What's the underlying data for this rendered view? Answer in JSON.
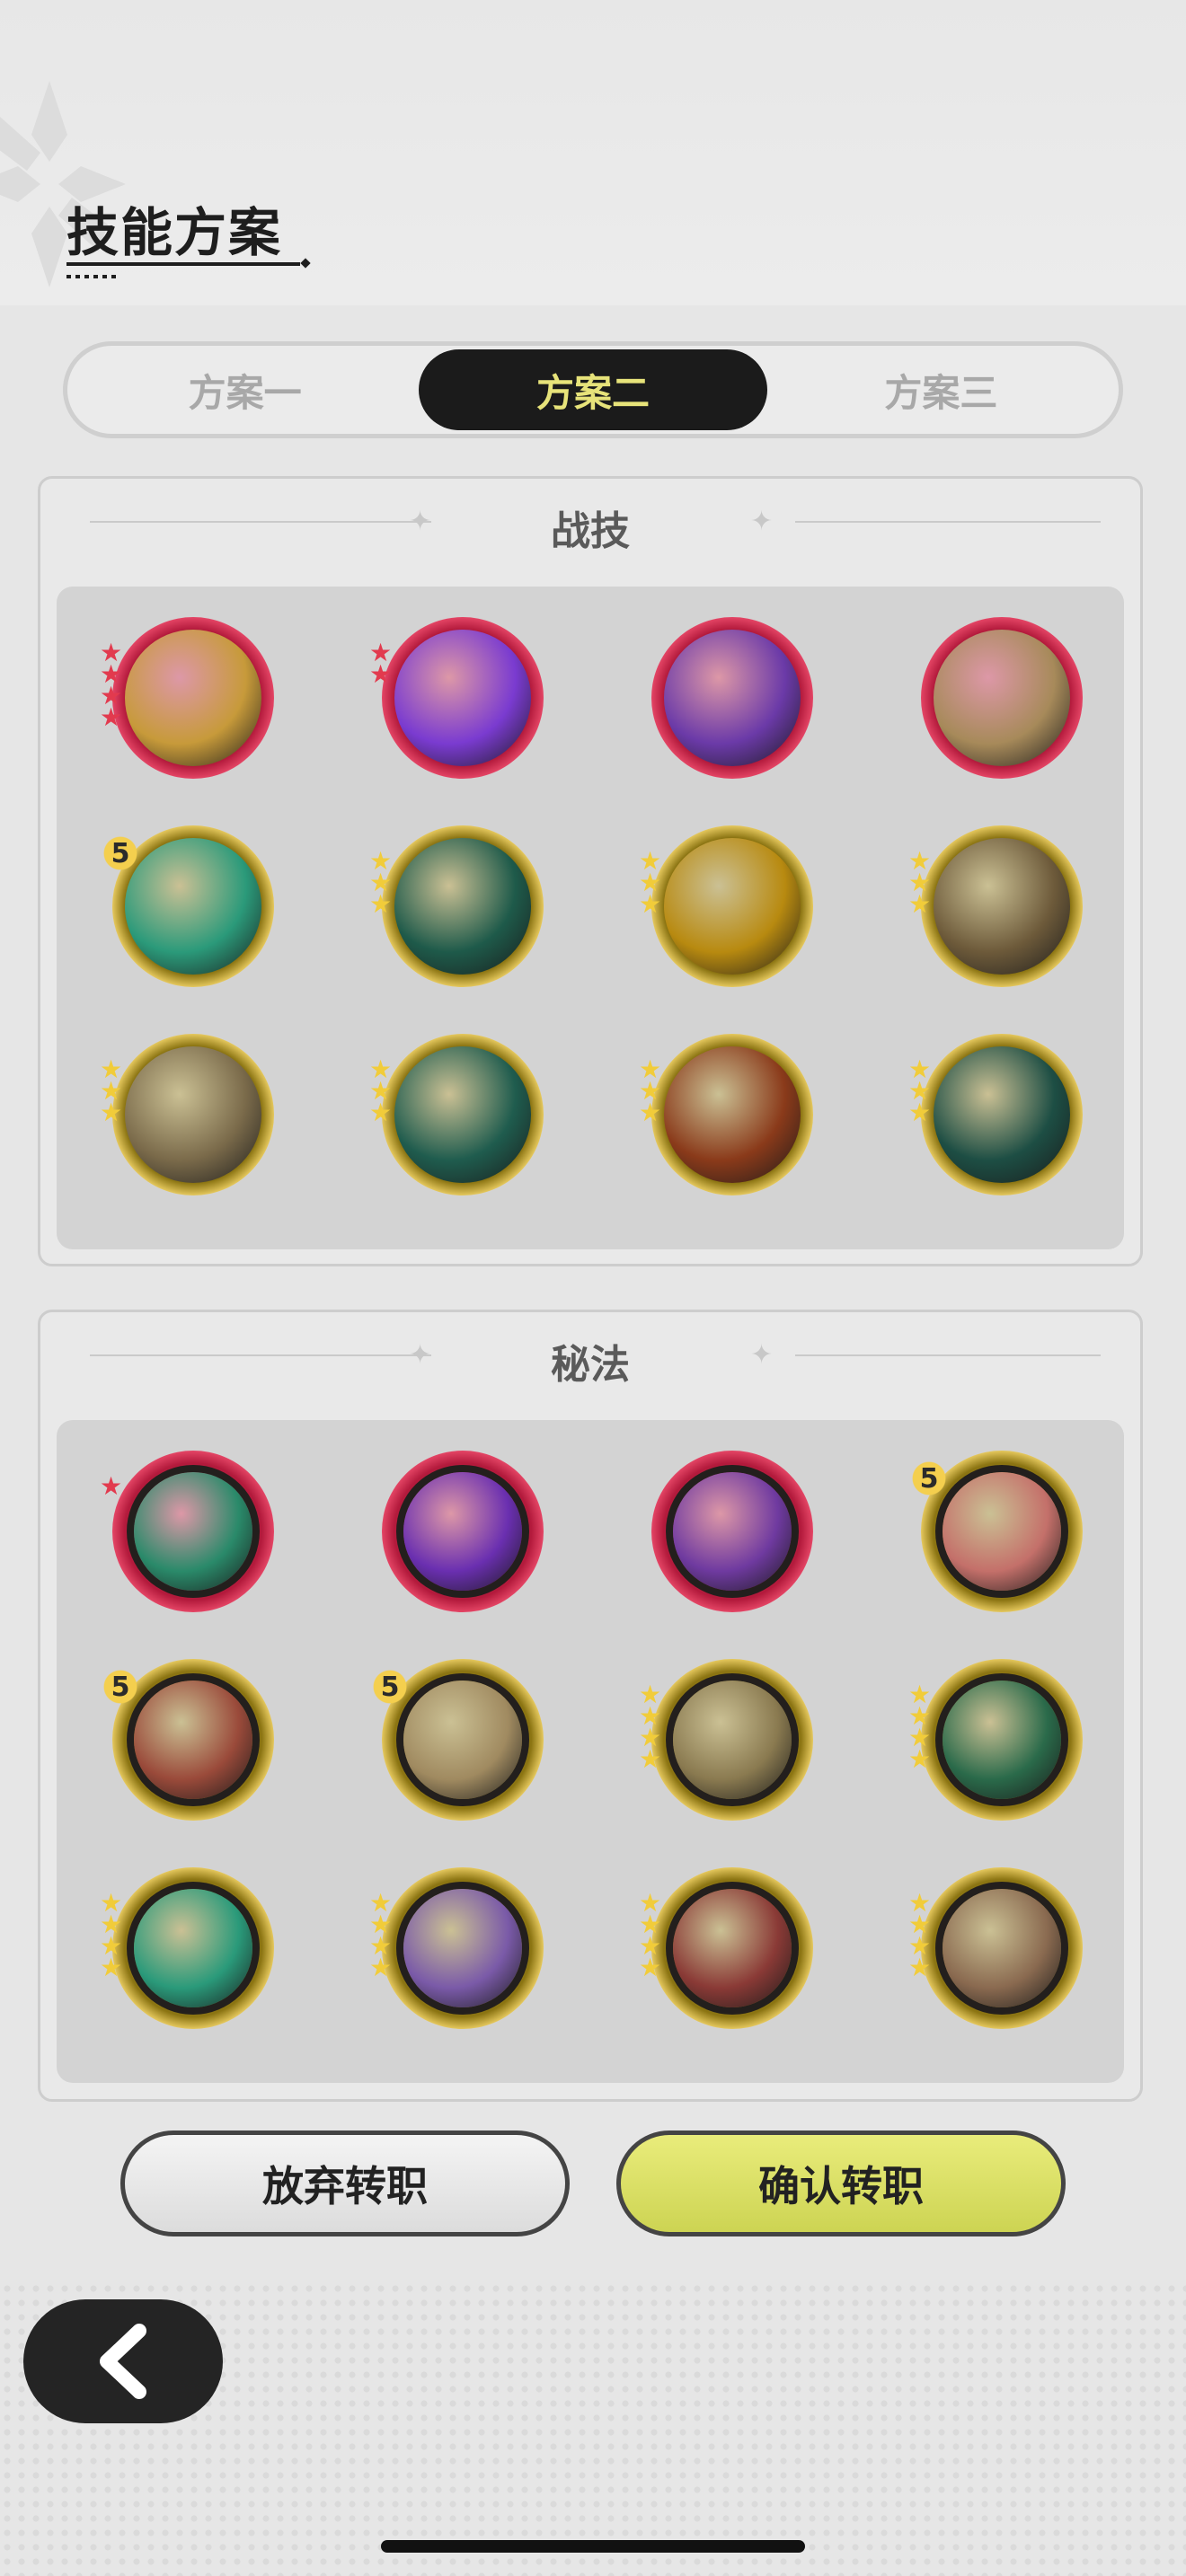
{
  "header": {
    "title": "技能方案"
  },
  "tabs": [
    {
      "label": "方案一",
      "active": false
    },
    {
      "label": "方案二",
      "active": true
    },
    {
      "label": "方案三",
      "active": false
    }
  ],
  "combat_panel": {
    "title": "战技",
    "icons": [
      {
        "name": "combat-skill-golden-swirl-icon",
        "frame": "red",
        "rank": 4,
        "rank_color": "red",
        "bg": "#c79a3a"
      },
      {
        "name": "combat-skill-purple-heart-icon",
        "frame": "red",
        "rank": 2,
        "rank_color": "red",
        "bg": "#7a3bd0"
      },
      {
        "name": "combat-skill-purple-claw-icon",
        "frame": "red",
        "rank": 0,
        "rank_color": "red",
        "bg": "#6b3aa8"
      },
      {
        "name": "combat-skill-dark-grab-icon",
        "frame": "red",
        "rank": 0,
        "rank_color": "red",
        "bg": "#a78a5a"
      },
      {
        "name": "combat-skill-green-rise-icon",
        "frame": "gold",
        "five": "5",
        "bg": "#2b9a7a"
      },
      {
        "name": "combat-skill-green-dash-icon",
        "frame": "gold",
        "rank": 3,
        "rank_color": "gold",
        "bg": "#1e5a4a"
      },
      {
        "name": "combat-skill-golden-shield-icon",
        "frame": "gold",
        "rank": 3,
        "rank_color": "gold",
        "bg": "#b88a10"
      },
      {
        "name": "combat-skill-crescent-slash-icon",
        "frame": "gold",
        "rank": 3,
        "rank_color": "gold",
        "bg": "#6d5a3a"
      },
      {
        "name": "combat-skill-impact-figure-icon",
        "frame": "gold",
        "rank": 3,
        "rank_color": "gold",
        "bg": "#7a6a4a"
      },
      {
        "name": "combat-skill-web-icon",
        "frame": "gold",
        "rank": 3,
        "rank_color": "gold",
        "bg": "#1f5c4e"
      },
      {
        "name": "combat-skill-flame-slash-icon",
        "frame": "gold",
        "rank": 3,
        "rank_color": "gold",
        "bg": "#8a3a1a"
      },
      {
        "name": "combat-skill-green-sword-icon",
        "frame": "gold",
        "rank": 3,
        "rank_color": "gold",
        "bg": "#1d4e44"
      }
    ]
  },
  "arcane_panel": {
    "title": "秘法",
    "icons": [
      {
        "name": "arcane-healing-totem-icon",
        "frame": "red",
        "rank": 1,
        "rank_color": "red",
        "bg": "#2a8a6a"
      },
      {
        "name": "arcane-purple-flame-icon",
        "frame": "red",
        "rank": 0,
        "rank_color": "red",
        "bg": "#6a2fb0"
      },
      {
        "name": "arcane-purple-figure-icon",
        "frame": "red",
        "rank": 0,
        "rank_color": "red",
        "bg": "#6f3aa0"
      },
      {
        "name": "arcane-sword-plus-icon",
        "frame": "gold",
        "five": "5",
        "bg": "#c4706a"
      },
      {
        "name": "arcane-red-shatter-icon",
        "frame": "gold",
        "five": "5",
        "bg": "#9a4a3a"
      },
      {
        "name": "arcane-leaf-icon",
        "frame": "gold",
        "five": "5",
        "bg": "#a08a60"
      },
      {
        "name": "arcane-armor-golem-icon",
        "frame": "gold",
        "rank": 4,
        "rank_color": "gold",
        "bg": "#8a7a50"
      },
      {
        "name": "arcane-green-heart-icon",
        "frame": "gold",
        "rank": 4,
        "rank_color": "gold",
        "bg": "#2a6a4a"
      },
      {
        "name": "arcane-green-blade-icon",
        "frame": "gold",
        "rank": 4,
        "rank_color": "gold",
        "bg": "#2a9a7a"
      },
      {
        "name": "arcane-purple-spirit-icon",
        "frame": "gold",
        "rank": 4,
        "rank_color": "gold",
        "bg": "#7a5aa8"
      },
      {
        "name": "arcane-red-armor-icon",
        "frame": "gold",
        "rank": 4,
        "rank_color": "gold",
        "bg": "#8a3a36"
      },
      {
        "name": "arcane-shield-heart-icon",
        "frame": "gold",
        "rank": 4,
        "rank_color": "gold",
        "bg": "#8a6a50"
      }
    ]
  },
  "buttons": {
    "abandon": "放弃转职",
    "confirm": "确认转职"
  },
  "colors": {
    "active_tab_bg": "#1b1b1b",
    "active_tab_text": "#e7e37a",
    "confirm_bg": "#d8dd5e",
    "red_frame": "#e24a6a",
    "gold_frame": "#e8c45a"
  }
}
